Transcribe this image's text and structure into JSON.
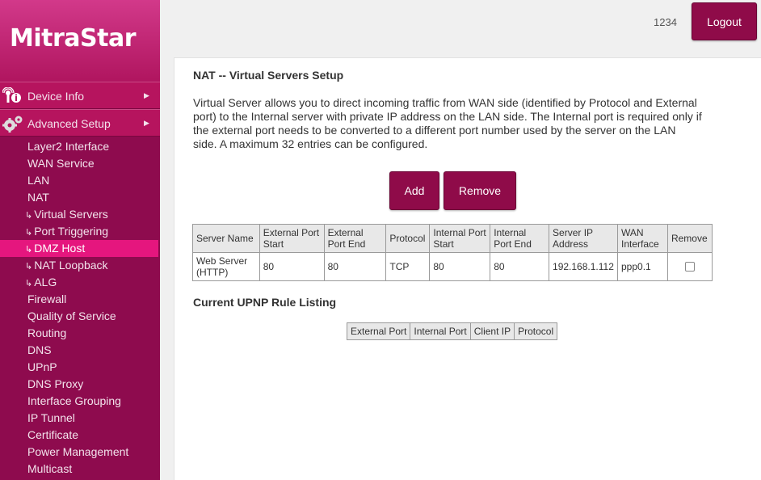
{
  "brand": {
    "logo_text": "MitraStar"
  },
  "header": {
    "user": "1234",
    "logout_label": "Logout"
  },
  "sidebar": {
    "main_items": [
      {
        "label": "Device Info",
        "icon": "device-info-icon"
      },
      {
        "label": "Advanced Setup",
        "icon": "gears-icon"
      }
    ],
    "sub_items": [
      {
        "label": "Layer2 Interface",
        "indent": false,
        "active": false
      },
      {
        "label": "WAN Service",
        "indent": false,
        "active": false
      },
      {
        "label": "LAN",
        "indent": false,
        "active": false
      },
      {
        "label": "NAT",
        "indent": false,
        "active": false
      },
      {
        "label": "Virtual Servers",
        "indent": true,
        "active": false
      },
      {
        "label": "Port Triggering",
        "indent": true,
        "active": false
      },
      {
        "label": "DMZ Host",
        "indent": true,
        "active": true
      },
      {
        "label": "NAT Loopback",
        "indent": true,
        "active": false
      },
      {
        "label": "ALG",
        "indent": true,
        "active": false
      },
      {
        "label": "Firewall",
        "indent": false,
        "active": false
      },
      {
        "label": "Quality of Service",
        "indent": false,
        "active": false
      },
      {
        "label": "Routing",
        "indent": false,
        "active": false
      },
      {
        "label": "DNS",
        "indent": false,
        "active": false
      },
      {
        "label": "UPnP",
        "indent": false,
        "active": false
      },
      {
        "label": "DNS Proxy",
        "indent": false,
        "active": false
      },
      {
        "label": "Interface Grouping",
        "indent": false,
        "active": false
      },
      {
        "label": "IP Tunnel",
        "indent": false,
        "active": false
      },
      {
        "label": "Certificate",
        "indent": false,
        "active": false
      },
      {
        "label": "Power Management",
        "indent": false,
        "active": false
      },
      {
        "label": "Multicast",
        "indent": false,
        "active": false
      }
    ]
  },
  "main": {
    "title": "NAT -- Virtual Servers Setup",
    "description": "Virtual Server allows you to direct incoming traffic from WAN side (identified by Protocol and External port) to the Internal server with private IP address on the LAN side. The Internal port is required only if the external port needs to be converted to a different port number used by the server on the LAN side. A maximum 32 entries can be configured.",
    "add_label": "Add",
    "remove_label": "Remove",
    "table": {
      "headers": [
        "Server Name",
        "External Port Start",
        "External Port End",
        "Protocol",
        "Internal Port Start",
        "Internal Port End",
        "Server IP Address",
        "WAN Interface",
        "Remove"
      ],
      "rows": [
        [
          "Web Server (HTTP)",
          "80",
          "80",
          "TCP",
          "80",
          "80",
          "192.168.1.112",
          "ppp0.1",
          ""
        ]
      ]
    },
    "upnp_title": "Current UPNP Rule Listing",
    "upnp_headers": [
      "External Port",
      "Internal Port",
      "Client IP",
      "Protocol"
    ]
  },
  "colors": {
    "sidebar_bg": "#8e0b4e",
    "menu_main_bg": "#b6145e",
    "active_item": "#e5167e",
    "button_bg": "#8f0b49"
  }
}
